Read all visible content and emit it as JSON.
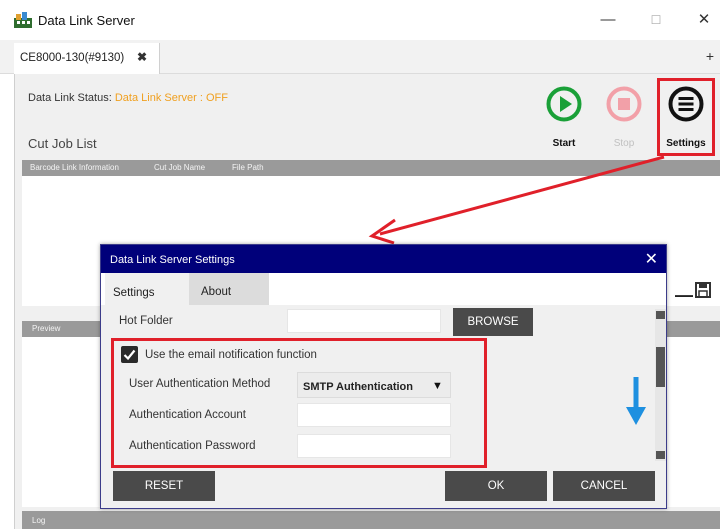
{
  "window": {
    "title": "Data Link Server",
    "minimize": "—",
    "maximize": "☐",
    "close": "✕"
  },
  "tabs": {
    "active_label": "CE8000-130(#9130)",
    "close_glyph": "✖",
    "add_glyph": "+"
  },
  "status": {
    "label": "Data Link Status:",
    "value": "Data Link Server : OFF",
    "value_color": "#f0a020"
  },
  "toolbar": {
    "start_label": "Start",
    "stop_label": "Stop",
    "settings_label": "Settings",
    "start_icon": "play-circle-icon",
    "stop_icon": "stop-circle-icon",
    "settings_icon": "menu-circle-icon"
  },
  "cut_job_list": {
    "title": "Cut Job List",
    "columns": [
      "Barcode Link Information",
      "Cut Job Name",
      "File Path"
    ]
  },
  "panels": {
    "preview_label": "Preview",
    "log_label": "Log"
  },
  "dialog": {
    "title": "Data Link Server Settings",
    "close_glyph": "✕",
    "tabs": [
      "Settings",
      "About"
    ],
    "hot_folder_label": "Hot Folder",
    "browse_label": "BROWSE",
    "email_checkbox_label": "Use the email notification function",
    "email_checkbox_checked": true,
    "auth_method_label": "User Authentication Method",
    "auth_method_value": "SMTP Authentication",
    "auth_account_label": "Authentication Account",
    "auth_password_label": "Authentication Password",
    "reset_label": "RESET",
    "ok_label": "OK",
    "cancel_label": "CANCEL"
  },
  "colors": {
    "accent_red": "#e0202a",
    "start_green": "#1aa038",
    "stop_pink": "#f2a0a8",
    "dialog_title_bg": "#00007a",
    "hint_arrow_blue": "#1e90e0"
  }
}
